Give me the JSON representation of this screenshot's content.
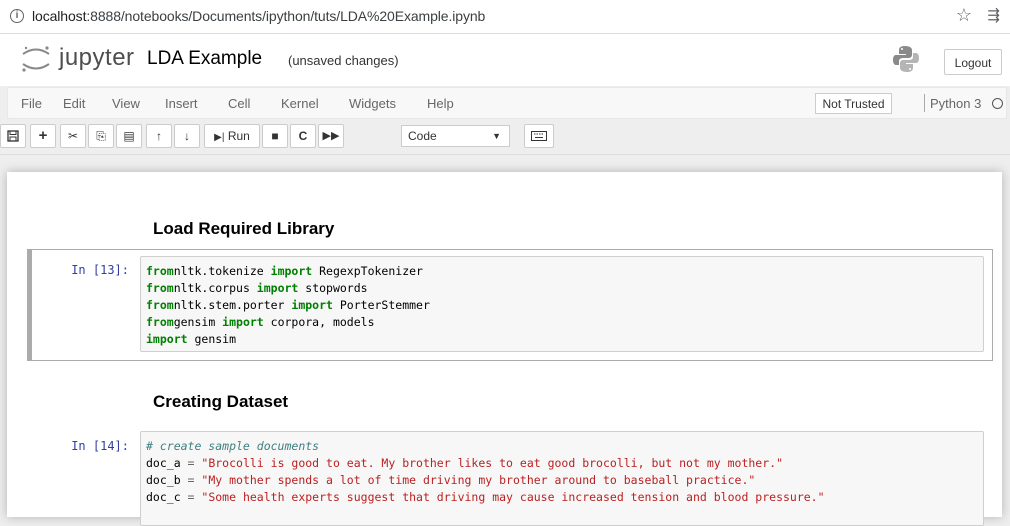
{
  "browser": {
    "url_host": "localhost",
    "url_rest": ":8888/notebooks/Documents/ipython/tuts/LDA%20Example.ipynb"
  },
  "header": {
    "brand": "jupyter",
    "notebook_name": "LDA Example",
    "save_status": "(unsaved changes)",
    "logout_label": "Logout"
  },
  "menubar": {
    "items": [
      "File",
      "Edit",
      "View",
      "Insert",
      "Cell",
      "Kernel",
      "Widgets",
      "Help"
    ],
    "trusted_label": "Not Trusted",
    "kernel_name": "Python 3"
  },
  "toolbar": {
    "run_label": "Run",
    "cell_type": "Code",
    "icons": [
      "save-icon",
      "plus-icon",
      "cut-icon",
      "copy-icon",
      "paste-icon",
      "arrow-up-icon",
      "arrow-down-icon",
      "run-icon",
      "stop-icon",
      "restart-icon",
      "fast-forward-icon",
      "keyboard-icon"
    ]
  },
  "notebook": {
    "heading1": "Load Required Library",
    "cell1": {
      "prompt": "In [13]:",
      "lines": [
        [
          [
            "kw",
            "from"
          ],
          [
            "",
            "nltk.tokenize"
          ],
          [
            "kw",
            " import"
          ],
          [
            "",
            " RegexpTokenizer"
          ]
        ],
        [
          [
            "kw",
            "from"
          ],
          [
            "",
            "nltk.corpus"
          ],
          [
            "kw",
            " import"
          ],
          [
            "",
            " stopwords"
          ]
        ],
        [
          [
            "kw",
            "from"
          ],
          [
            "",
            "nltk.stem.porter"
          ],
          [
            "kw",
            " import"
          ],
          [
            "",
            " PorterStemmer"
          ]
        ],
        [
          [
            "kw",
            "from"
          ],
          [
            "",
            "gensim"
          ],
          [
            "kw",
            " import"
          ],
          [
            "",
            " corpora, models"
          ]
        ],
        [
          [
            "kw",
            "import"
          ],
          [
            "",
            " gensim"
          ]
        ]
      ]
    },
    "heading2": "Creating Dataset",
    "cell2": {
      "prompt": "In [14]:",
      "lines": [
        [
          [
            "cmt",
            "# create sample documents"
          ]
        ],
        [
          [
            "",
            "doc_a"
          ],
          [
            "op",
            " ="
          ],
          [
            "str",
            " \"Brocolli is good to eat. My brother likes to eat good brocolli, but not my mother.\""
          ]
        ],
        [
          [
            "",
            "doc_b"
          ],
          [
            "op",
            " ="
          ],
          [
            "str",
            " \"My mother spends a lot of time driving my brother around to baseball practice.\""
          ]
        ],
        [
          [
            "",
            "doc_c"
          ],
          [
            "op",
            " ="
          ],
          [
            "str",
            " \"Some health experts suggest that driving may cause increased tension and blood pressure.\""
          ]
        ]
      ]
    }
  }
}
